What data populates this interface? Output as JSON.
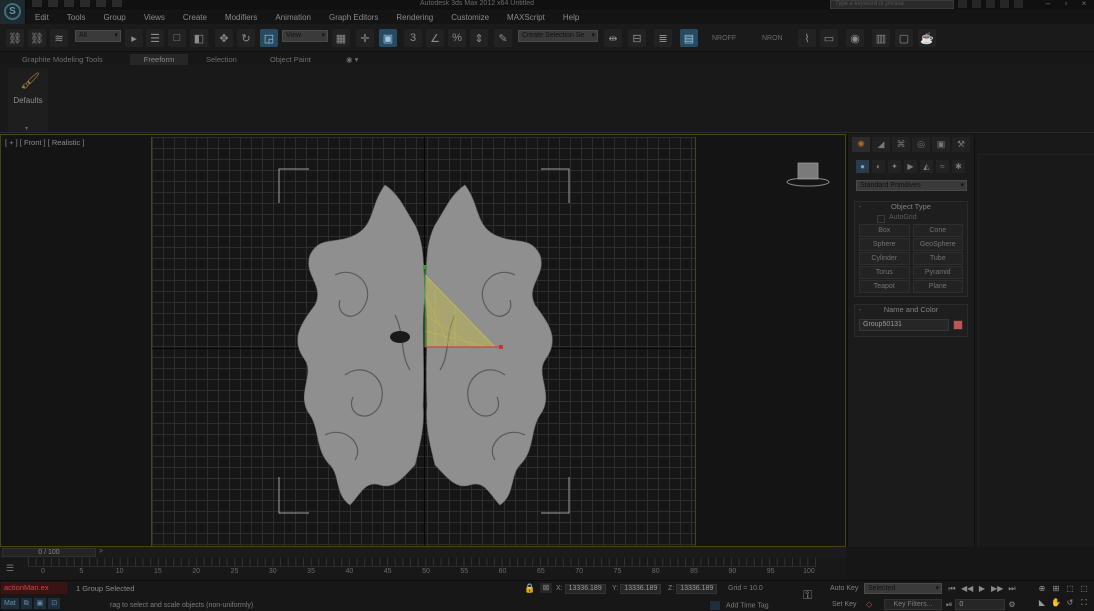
{
  "app": {
    "title": "Autodesk 3ds Max  2012 x64        Untitled",
    "help_search_placeholder": "Type a keyword or phrase",
    "logo_icon": "3dsmax-logo-icon"
  },
  "menu": [
    "Edit",
    "Tools",
    "Group",
    "Views",
    "Create",
    "Modifiers",
    "Animation",
    "Graph Editors",
    "Rendering",
    "Customize",
    "MAXScript",
    "Help"
  ],
  "toolbar": {
    "selection_filter": "All",
    "ref_coord": "View",
    "named_selection": "Create Selection Se",
    "nroff_label": "NROFF",
    "nron_label": "NRON"
  },
  "ribbon": {
    "tabs": [
      {
        "label": "Graphite Modeling Tools",
        "active": false
      },
      {
        "label": "Freeform",
        "active": true
      },
      {
        "label": "Selection",
        "active": false
      },
      {
        "label": "Object Paint",
        "active": false
      }
    ],
    "defaults_label": "Defaults"
  },
  "viewport": {
    "label": "[ + ] [ Front ] [ Realistic ]"
  },
  "command_panel": {
    "category": "Standard Primitives",
    "object_type_title": "Object Type",
    "autogrid_label": "AutoGrid",
    "primitives": [
      "Box",
      "Cone",
      "Sphere",
      "GeoSphere",
      "Cylinder",
      "Tube",
      "Torus",
      "Pyramid",
      "Teapot",
      "Plane"
    ],
    "name_color_title": "Name and Color",
    "object_name": "Group50131",
    "object_color": "#c2534d"
  },
  "timeline": {
    "frame_readout": "0 / 100",
    "ticks": [
      "0",
      "5",
      "10",
      "15",
      "20",
      "25",
      "30",
      "35",
      "40",
      "45",
      "50",
      "55",
      "60",
      "65",
      "70",
      "75",
      "80",
      "85",
      "90",
      "95",
      "100"
    ]
  },
  "status": {
    "maxscript_text": "actionMan.ex",
    "mini_buttons": [
      "Mat",
      "",
      "",
      ""
    ],
    "selection_text": "1 Group Selected",
    "prompt_text": "rag to select and scale objects (non-uniformly)",
    "x_label": "X:",
    "x_value": "13336.189",
    "y_label": "Y:",
    "y_value": "13336.189",
    "z_label": "Z:",
    "z_value": "13336.189",
    "grid_text": "Grid = 10.0",
    "add_time_tag": "Add Time Tag",
    "auto_key": "Auto Key",
    "set_key": "Set Key",
    "selected_dropdown": "Selected",
    "key_filters": "Key Filters...",
    "frame_value": "0"
  },
  "colors": {
    "viewport_border": "#494214",
    "active_tab_orange": "#b06824",
    "selection_yellow": "#c8c24a"
  }
}
